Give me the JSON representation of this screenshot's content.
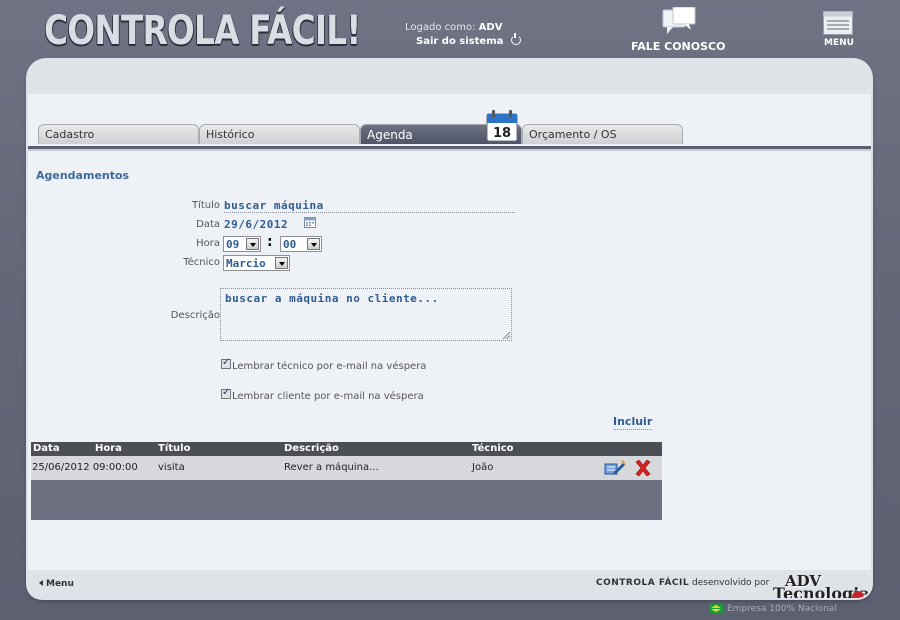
{
  "header": {
    "logo": "CONTROLA FÁCIL!",
    "logged_as_label": "Logado como:",
    "logged_as_user": "ADV",
    "logout": "Sair do sistema",
    "contact": "FALE CONOSCO",
    "menu": "MENU"
  },
  "tabs": [
    {
      "label": "Cadastro"
    },
    {
      "label": "Histórico"
    },
    {
      "label": "Agenda",
      "active": true
    },
    {
      "label": "Orçamento / OS"
    }
  ],
  "calendar_day": "18",
  "form": {
    "section_title": "Agendamentos",
    "title_label": "Título",
    "title_value": "buscar máquina",
    "date_label": "Data",
    "date_value": "29/6/2012",
    "time_label": "Hora",
    "hour_value": "09",
    "minute_value": "00",
    "time_separator": ":",
    "technician_label": "Técnico",
    "technician_value": "Marcio",
    "description_label": "Descrição",
    "description_value": "buscar a máquina no cliente...",
    "remind_technician": "Lembrar técnico por e-mail na véspera",
    "remind_technician_checked": true,
    "remind_client": "Lembrar cliente por e-mail na véspera",
    "remind_client_checked": true,
    "include_button": "Incluir"
  },
  "table": {
    "columns": [
      "Data",
      "Hora",
      "Título",
      "Descrição",
      "Técnico"
    ],
    "rows": [
      {
        "date_time": "25/06/2012 09:00:00",
        "title": "visita",
        "description": "Rever a máquina...",
        "technician": "João"
      }
    ]
  },
  "footer": {
    "menu": "Menu",
    "product": "CONTROLA FÁCIL",
    "developed_by": "desenvolvido por",
    "company_line1": "ADV",
    "company_line2": "Tecnologia",
    "tagline": "Empresa 100% Nacional"
  },
  "colors": {
    "accent": "#2f5d92",
    "active_tab": "#5a5f71",
    "delete": "#d8211f"
  }
}
